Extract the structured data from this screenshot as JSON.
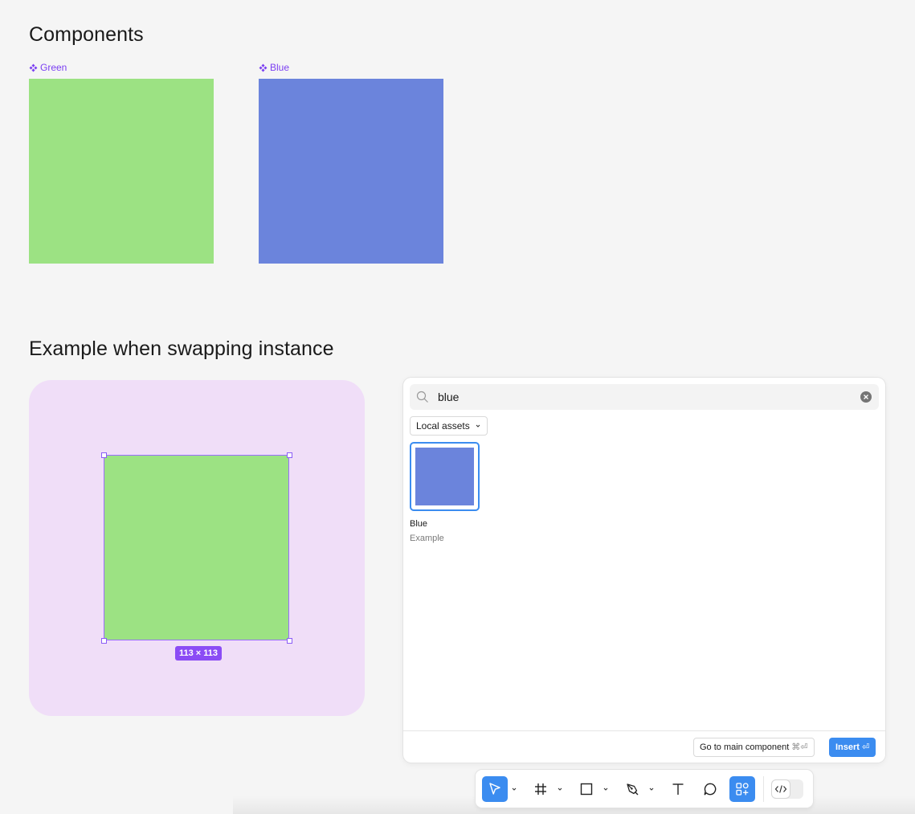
{
  "canvas": {
    "components_heading": "Components",
    "example_heading": "Example when swapping instance",
    "components": [
      {
        "label": "Green",
        "color": "#9ce283",
        "icon": "component-icon"
      },
      {
        "label": "Blue",
        "color": "#6b84dc",
        "icon": "component-icon"
      }
    ],
    "frame_color": "#f0def8",
    "instance": {
      "color": "#9ce283",
      "size_badge": "113 × 113",
      "selection_color": "#8b4cf5"
    }
  },
  "swap_panel": {
    "search": {
      "value": "blue",
      "placeholder": "Search"
    },
    "filter_label": "Local assets",
    "assets": [
      {
        "name": "Blue",
        "library": "Example",
        "color": "#6b84dc",
        "selected": true
      }
    ],
    "footer": {
      "secondary_label": "Go to main component",
      "secondary_shortcut": "⌘⏎",
      "primary_label": "Insert",
      "primary_shortcut": "⏎"
    },
    "accent": "#3b8cf0"
  },
  "toolbar": {
    "tools": [
      {
        "name": "move-tool",
        "icon": "cursor-arrow-icon",
        "active": true
      },
      {
        "name": "frame-tool",
        "icon": "frame-hash-icon",
        "active": false
      },
      {
        "name": "shape-tool",
        "icon": "rectangle-icon",
        "active": false
      },
      {
        "name": "pen-tool",
        "icon": "pen-nib-icon",
        "active": false
      },
      {
        "name": "text-tool",
        "icon": "text-t-icon",
        "active": false
      },
      {
        "name": "comment-tool",
        "icon": "speech-bubble-icon",
        "active": false
      },
      {
        "name": "assets-tool",
        "icon": "shapes-plus-icon",
        "active": true
      }
    ],
    "dev_mode_icon": "code-brackets-icon"
  }
}
